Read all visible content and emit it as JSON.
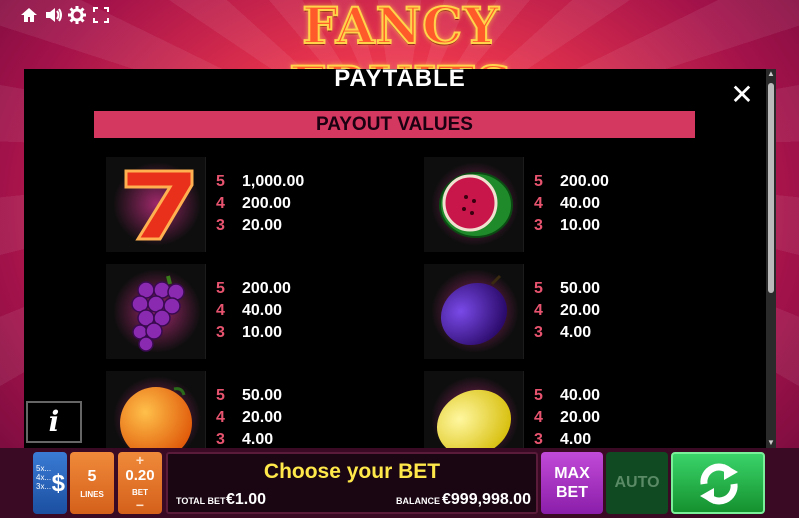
{
  "topbar": {
    "icons": [
      "home-icon",
      "sound-icon",
      "gear-icon",
      "fullscreen-icon"
    ]
  },
  "logo_text": "FANCY FRUITS",
  "panel": {
    "title": "PAYTABLE",
    "section_label": "PAYOUT VALUES",
    "close_glyph": "✕"
  },
  "symbols": [
    {
      "name": "seven",
      "rows": [
        {
          "count": "5",
          "value": "1,000.00"
        },
        {
          "count": "4",
          "value": "200.00"
        },
        {
          "count": "3",
          "value": "20.00"
        }
      ]
    },
    {
      "name": "watermelon",
      "rows": [
        {
          "count": "5",
          "value": "200.00"
        },
        {
          "count": "4",
          "value": "40.00"
        },
        {
          "count": "3",
          "value": "10.00"
        }
      ]
    },
    {
      "name": "grapes",
      "rows": [
        {
          "count": "5",
          "value": "200.00"
        },
        {
          "count": "4",
          "value": "40.00"
        },
        {
          "count": "3",
          "value": "10.00"
        }
      ]
    },
    {
      "name": "plum",
      "rows": [
        {
          "count": "5",
          "value": "50.00"
        },
        {
          "count": "4",
          "value": "20.00"
        },
        {
          "count": "3",
          "value": "4.00"
        }
      ]
    },
    {
      "name": "orange",
      "rows": [
        {
          "count": "5",
          "value": "50.00"
        },
        {
          "count": "4",
          "value": "20.00"
        },
        {
          "count": "3",
          "value": "4.00"
        }
      ]
    },
    {
      "name": "lemon",
      "rows": [
        {
          "count": "5",
          "value": "40.00"
        },
        {
          "count": "4",
          "value": "20.00"
        },
        {
          "count": "3",
          "value": "4.00"
        }
      ]
    }
  ],
  "info_label": "i",
  "bottom": {
    "coin_labels": [
      "5x...",
      "4x...",
      "3x..."
    ],
    "coin_symbol": "$",
    "lines_value": "5",
    "lines_label": "LINES",
    "bet_plus": "+",
    "bet_value": "0.20",
    "bet_label": "BET",
    "bet_minus": "−",
    "message": "Choose your BET",
    "total_bet_label": "TOTAL BET",
    "total_bet_value": "€1.00",
    "balance_label": "BALANCE",
    "balance_value": "€999,998.00",
    "max_bet_line1": "MAX",
    "max_bet_line2": "BET",
    "auto_label": "AUTO"
  },
  "colors": {
    "accent_pink": "#d4375f",
    "count_pink": "#e8546f",
    "message_yellow": "#ffe84a",
    "spin_green": "#2ab850"
  }
}
